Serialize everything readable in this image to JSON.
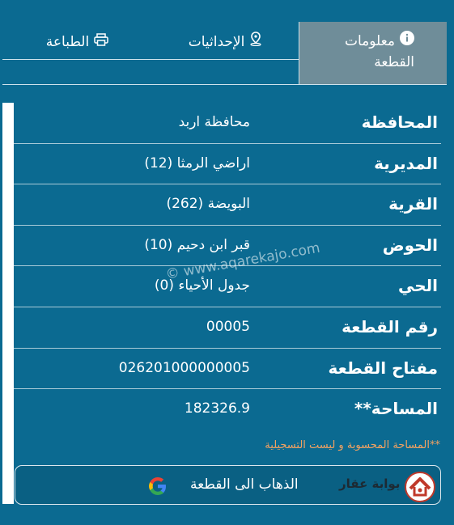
{
  "tabs": {
    "info_label": "معلومات القطعة",
    "coords_label": "الإحداثيات",
    "print_label": "الطباعة"
  },
  "rows": [
    {
      "label": "المحافظة",
      "value": "محافظة اربد"
    },
    {
      "label": "المديرية",
      "value": "اراضي الرمثا (12)"
    },
    {
      "label": "القرية",
      "value": "البويضة (262)"
    },
    {
      "label": "الحوض",
      "value": "قبر ابن دحيم (10)"
    },
    {
      "label": "الحي",
      "value": "جدول الأحياء (0)"
    },
    {
      "label": "رقم القطعة",
      "value": "00005"
    },
    {
      "label": "مفتاح القطعة",
      "value": "026201000000005"
    },
    {
      "label": "المساحة**",
      "value": "182326.9"
    }
  ],
  "note": "**المساحة المحسوبة و ليست التسجيلية",
  "goto": {
    "label": "الذهاب الى القطعة",
    "brand": "بوابة عقار"
  },
  "watermark": "© www.aqarekajo.com",
  "colors": {
    "background": "#0b6a91",
    "active_tab": "#6f8d99",
    "note": "#f4a261"
  }
}
